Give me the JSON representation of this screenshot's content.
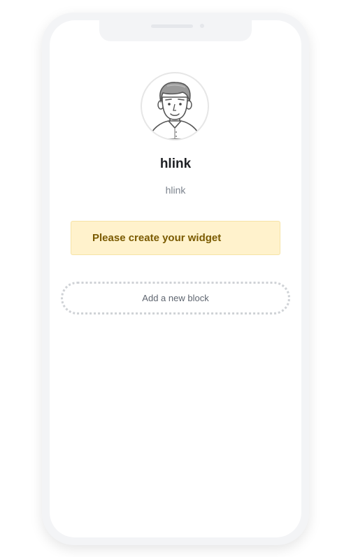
{
  "profile": {
    "name": "hlink",
    "handle": "hlink",
    "avatar_icon": "user-avatar-icon"
  },
  "alert": {
    "message": "Please create your widget",
    "background": "#fff2cc",
    "text_color": "#7a5a00"
  },
  "actions": {
    "add_block_label": "Add a new block"
  }
}
